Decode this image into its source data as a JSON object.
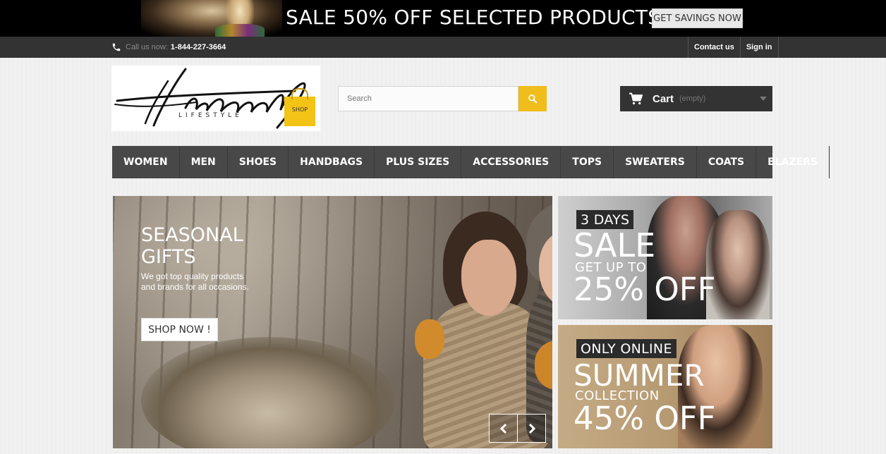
{
  "promo": {
    "text": "SALE 50% OFF  SELECTED PRODUCTS",
    "button": "GET SAVINGS NOW"
  },
  "topbar": {
    "call_label": "Call us now:",
    "phone": "1-844-227-3664",
    "contact": "Contact us",
    "signin": "Sign in"
  },
  "logo": {
    "tagline": "LIFESTYLE",
    "bag_label": "SHOP"
  },
  "search": {
    "placeholder": "Search"
  },
  "cart": {
    "label": "Cart",
    "status": "(empty)"
  },
  "menu": {
    "items": [
      "WOMEN",
      "MEN",
      "SHOES",
      "HANDBAGS",
      "PLUS SIZES",
      "ACCESSORIES",
      "TOPS",
      "SWEATERS",
      "COATS",
      "BLAZERS"
    ]
  },
  "slider": {
    "title": "SEASONAL GIFTS",
    "description": "We got top quality products and brands for all occasions.",
    "button": "SHOP NOW !"
  },
  "banners": [
    {
      "tag": "3 DAYS",
      "line1": "SALE",
      "line2": "GET UP TO",
      "line3": "25% OFF"
    },
    {
      "tag": "ONLY ONLINE",
      "line1": "SUMMER",
      "line2": "COLLECTION",
      "line3": "45% OFF"
    }
  ],
  "colors": {
    "accent": "#f0bd1b",
    "dark": "#333333",
    "menu": "#484848"
  }
}
